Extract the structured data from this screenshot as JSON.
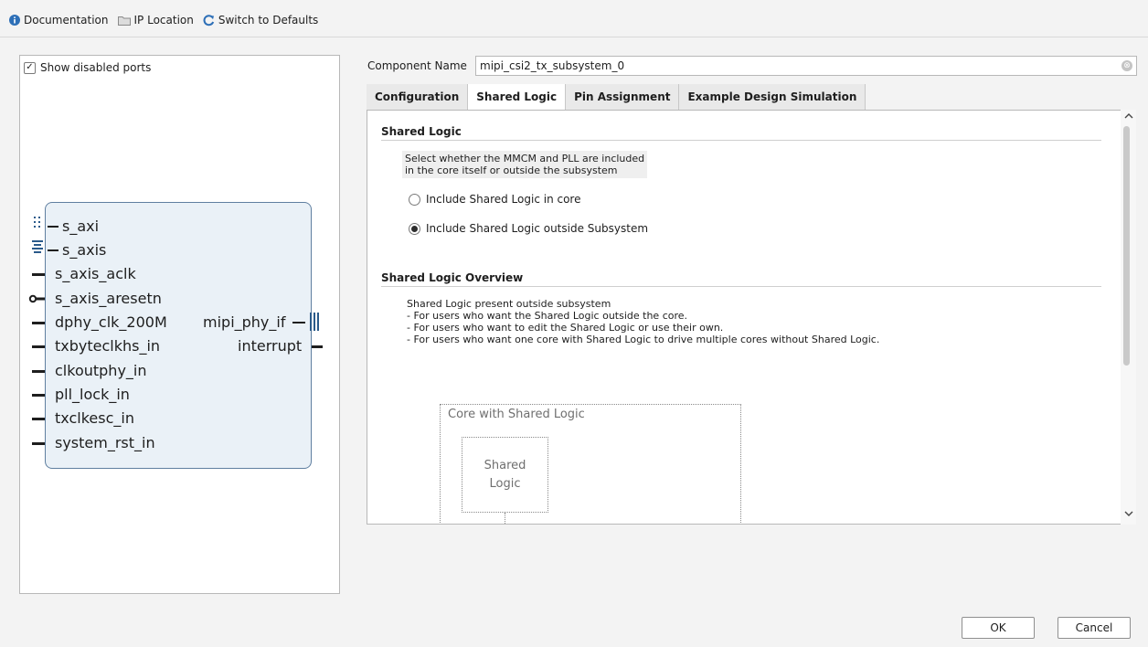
{
  "toolbar": {
    "documentation": "Documentation",
    "ip_location": "IP Location",
    "switch_defaults": "Switch to Defaults"
  },
  "symbol": {
    "show_disabled_ports": "Show disabled ports",
    "show_disabled_checked": true,
    "left_ports": [
      "s_axi",
      "s_axis",
      "s_axis_aclk",
      "s_axis_aresetn",
      "dphy_clk_200M",
      "txbyteclkhs_in",
      "clkoutphy_in",
      "pll_lock_in",
      "txclkesc_in",
      "system_rst_in"
    ],
    "right_ports": [
      "mipi_phy_if",
      "interrupt"
    ]
  },
  "component": {
    "label": "Component Name",
    "value": "mipi_csi2_tx_subsystem_0"
  },
  "tabs": [
    "Configuration",
    "Shared Logic",
    "Pin Assignment",
    "Example Design Simulation"
  ],
  "active_tab": "Shared Logic",
  "shared_logic": {
    "title": "Shared Logic",
    "description": [
      "Select whether the MMCM and PLL are included",
      "in the core itself or outside the subsystem"
    ],
    "option_core": "Include Shared Logic in core",
    "option_outside": "Include Shared Logic outside Subsystem",
    "selected": "outside"
  },
  "overview": {
    "title": "Shared Logic Overview",
    "lines": [
      "Shared Logic present outside subsystem",
      "- For users who want the Shared Logic outside the core.",
      "- For users who want to edit the Shared Logic or use their own.",
      "- For users who want one core with Shared Logic to drive multiple cores without Shared Logic."
    ],
    "diagram_outer": "Core with Shared Logic",
    "diagram_inner": [
      "Shared",
      "Logic"
    ]
  },
  "buttons": {
    "ok": "OK",
    "cancel": "Cancel"
  },
  "colors": {
    "block_fill": "#eaf1f7",
    "block_border": "#5f7fa0",
    "bus_color": "#2a5a8a",
    "info_icon": "#2d6fb7"
  }
}
